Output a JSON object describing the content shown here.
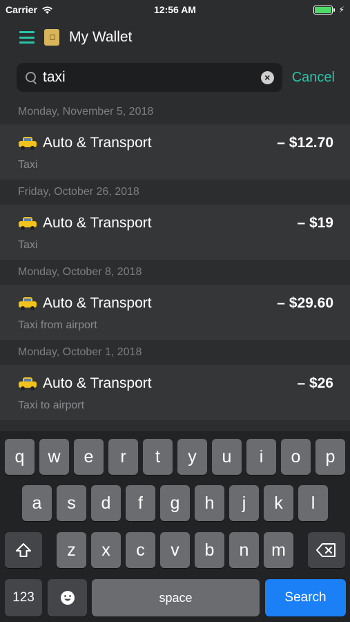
{
  "status_bar": {
    "carrier": "Carrier",
    "time": "12:56 AM",
    "battery_level": 1.0
  },
  "header": {
    "title": "My Wallet",
    "menu_icon": "hamburger-menu-icon",
    "app_icon": "wallet-icon"
  },
  "search": {
    "value": "taxi",
    "cancel_label": "Cancel"
  },
  "transactions": [
    {
      "date": "Monday, November 5, 2018",
      "category": "Auto & Transport",
      "amount": "– $12.70",
      "note": "Taxi"
    },
    {
      "date": "Friday, October 26, 2018",
      "category": "Auto & Transport",
      "amount": "– $19",
      "note": "Taxi"
    },
    {
      "date": "Monday, October 8, 2018",
      "category": "Auto & Transport",
      "amount": "– $29.60",
      "note": "Taxi from airport"
    },
    {
      "date": "Monday, October 1, 2018",
      "category": "Auto & Transport",
      "amount": "– $26",
      "note": "Taxi to airport"
    }
  ],
  "keyboard": {
    "row1": [
      "q",
      "w",
      "e",
      "r",
      "t",
      "y",
      "u",
      "i",
      "o",
      "p"
    ],
    "row2": [
      "a",
      "s",
      "d",
      "f",
      "g",
      "h",
      "j",
      "k",
      "l"
    ],
    "row3": [
      "z",
      "x",
      "c",
      "v",
      "b",
      "n",
      "m"
    ],
    "numbers_label": "123",
    "space_label": "space",
    "search_label": "Search"
  },
  "colors": {
    "accent": "#26c6a8",
    "search_key": "#1b80f6",
    "background": "#2c2d2f",
    "row_background": "#353638"
  }
}
